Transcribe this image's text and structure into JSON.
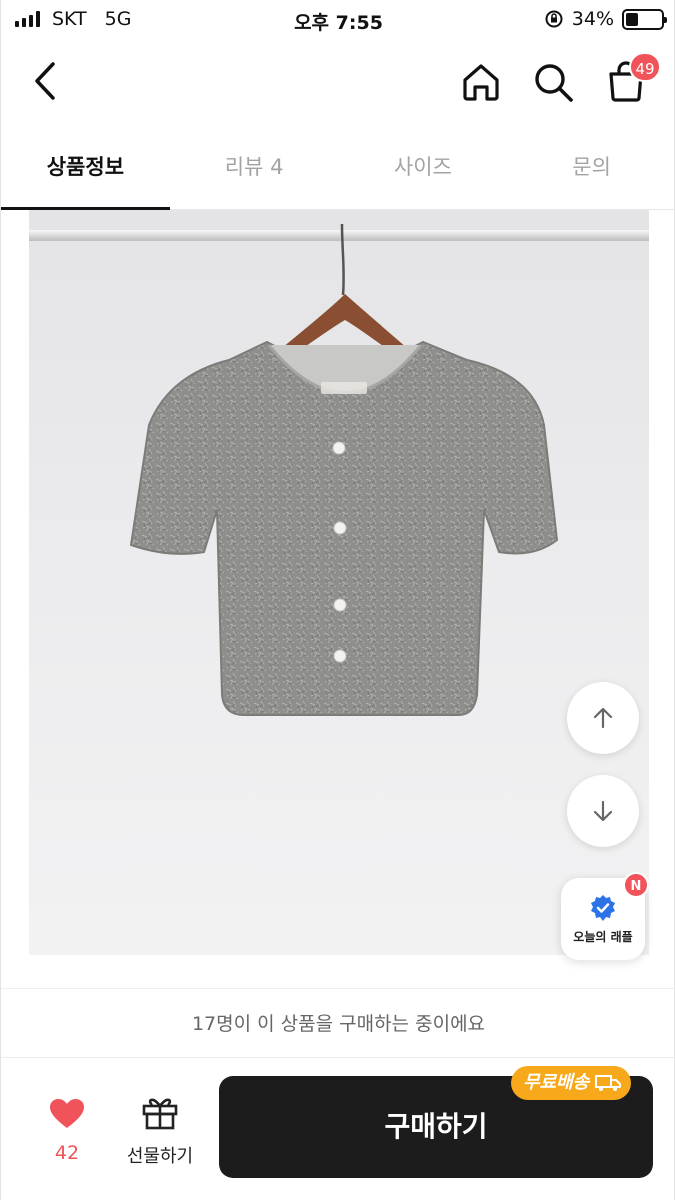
{
  "status_bar": {
    "carrier": "SKT",
    "network": "5G",
    "time": "오후 7:55",
    "battery": "34%",
    "battery_level": 0.34
  },
  "header": {
    "back_icon": "chevron-left-icon",
    "home_icon": "home-icon",
    "search_icon": "search-icon",
    "cart_icon": "shopping-bag-icon",
    "cart_count": "49",
    "badge_color": "#f0545a"
  },
  "tabs": [
    {
      "label": "상품정보",
      "active": true
    },
    {
      "label": "리뷰 4",
      "active": false
    },
    {
      "label": "사이즈",
      "active": false
    },
    {
      "label": "문의",
      "active": false
    }
  ],
  "product_image": {
    "description_icon": "gray-fuzzy-cardigan-on-hanger"
  },
  "floating": {
    "scroll_up_icon": "arrow-up-icon",
    "scroll_down_icon": "arrow-down-icon",
    "raffle_label": "오늘의 래플",
    "raffle_badge": "N",
    "raffle_icon": "verified-badge-icon"
  },
  "buyers_text": "17명이 이 상품을 구매하는 중이에요",
  "bottom_bar": {
    "like_icon": "heart-icon",
    "like_count": "42",
    "gift_icon": "gift-icon",
    "gift_label": "선물하기",
    "buy_label": "구매하기",
    "free_shipping_label": "무료배송",
    "accent_color": "#f7a81b",
    "buy_color": "#1c1c1c"
  }
}
